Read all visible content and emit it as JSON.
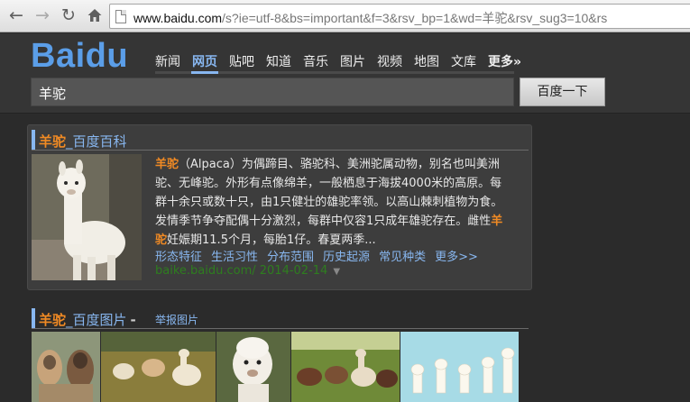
{
  "browser": {
    "url_host": "www.baidu.com",
    "url_path": "/s?ie=utf-8&bs=important&f=3&rsv_bp=1&wd=羊驼&rsv_sug3=10&rs"
  },
  "header": {
    "logo": "Baidu",
    "nav": [
      "新闻",
      "网页",
      "贴吧",
      "知道",
      "音乐",
      "图片",
      "视频",
      "地图",
      "文库",
      "更多»"
    ],
    "active_nav": "网页",
    "search_value": "羊驼",
    "search_button": "百度一下"
  },
  "baike": {
    "title_highlight": "羊驼",
    "title_rest": "_百度百科",
    "desc_highlight_1": "羊驼",
    "desc_part_1": "（Alpaca）为偶蹄目、骆驼科、美洲驼属动物，别名也叫美洲驼、无峰驼。外形有点像绵羊，一般栖息于海拔4000米的高原。每群十余只或数十只，由1只健壮的雄驼率领。以高山棘刺植物为食。发情季节争夺配偶十分激烈，每群中仅容1只成年雄驼存在。雌性",
    "desc_highlight_2": "羊驼",
    "desc_part_2": "妊娠期11.5个月，每胎1仔。春夏两季...",
    "links": [
      "形态特征",
      "生活习性",
      "分布范围",
      "历史起源",
      "常见种类",
      "更多>>"
    ],
    "url": "baike.baidu.com/ 2014-02-14"
  },
  "images": {
    "title_highlight": "羊驼",
    "title_rest": "_百度图片",
    "dash": "-",
    "report_link": "举报图片"
  },
  "colors": {
    "background": "#2b2b2b",
    "link": "#88b7f0",
    "highlight": "#f08a24",
    "url_green": "#2e7d1f",
    "logo": "#5b9ee8"
  }
}
